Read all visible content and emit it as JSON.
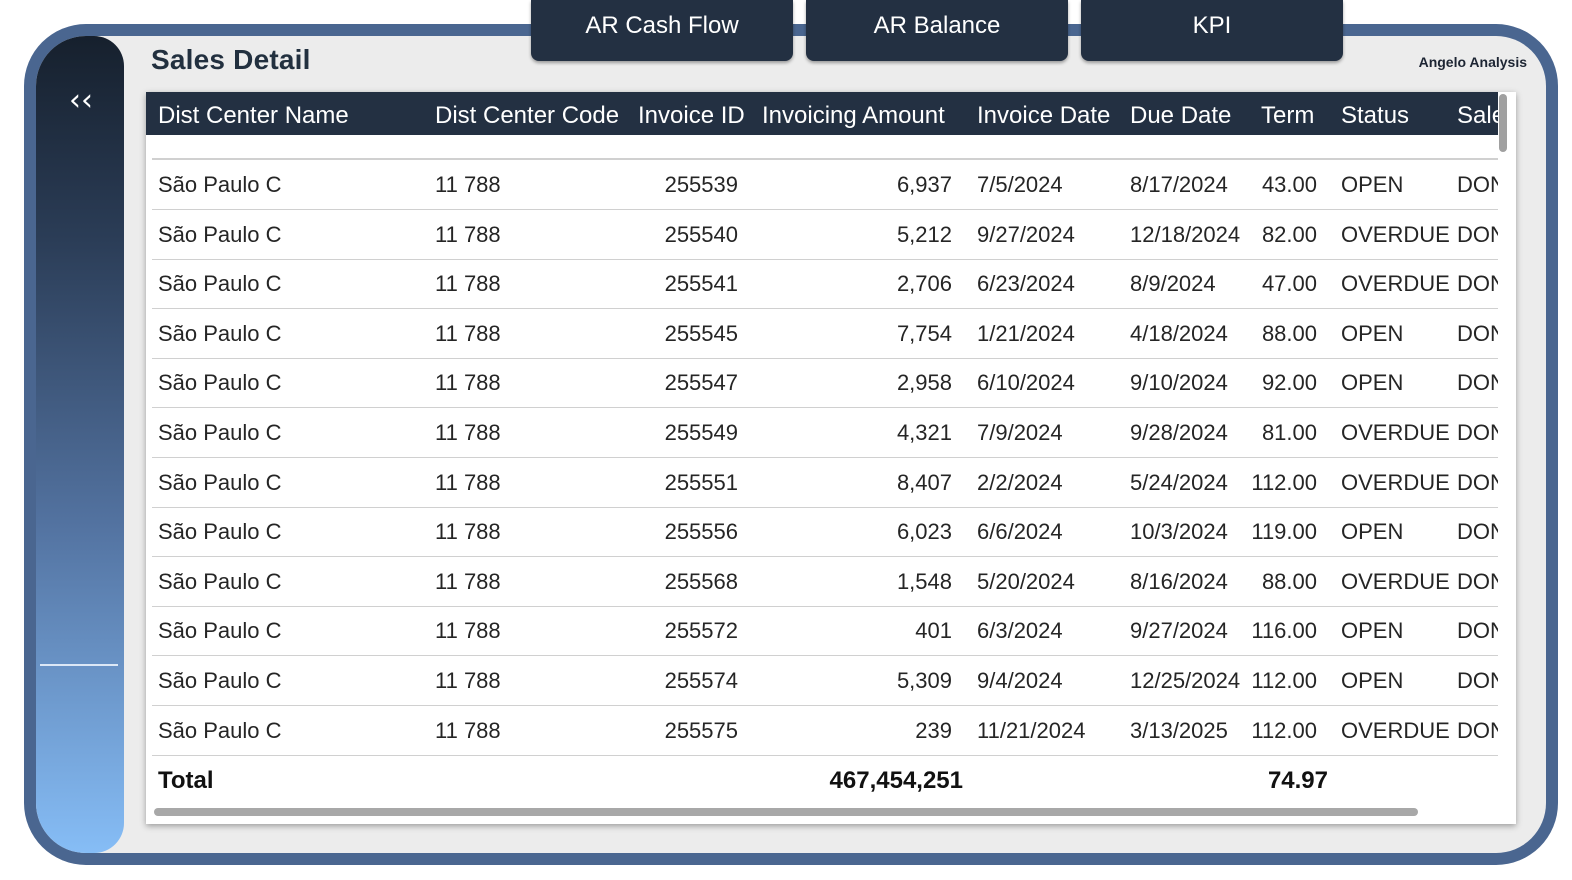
{
  "tabs": [
    {
      "label": "AR Cash Flow"
    },
    {
      "label": "AR Balance"
    },
    {
      "label": "KPI"
    }
  ],
  "sidebar": {
    "collapse_icon": "double-chevron-left-icon",
    "collapse_glyph": "‹‹"
  },
  "page": {
    "title": "Sales Detail",
    "brand": "Angelo Analysis"
  },
  "table": {
    "columns": [
      "Dist Center Name",
      "Dist Center Code",
      "Invoice ID",
      "Invoicing Amount",
      "Invoice Date",
      "Due Date",
      "Term",
      "Status",
      "Sale"
    ],
    "rows": [
      [
        "São Paulo C",
        "11 788",
        "255539",
        "6,937",
        "7/5/2024",
        "8/17/2024",
        "43.00",
        "OPEN",
        "DON"
      ],
      [
        "São Paulo C",
        "11 788",
        "255540",
        "5,212",
        "9/27/2024",
        "12/18/2024",
        "82.00",
        "OVERDUE",
        "DON"
      ],
      [
        "São Paulo C",
        "11 788",
        "255541",
        "2,706",
        "6/23/2024",
        "8/9/2024",
        "47.00",
        "OVERDUE",
        "DON"
      ],
      [
        "São Paulo C",
        "11 788",
        "255545",
        "7,754",
        "1/21/2024",
        "4/18/2024",
        "88.00",
        "OPEN",
        "DON"
      ],
      [
        "São Paulo C",
        "11 788",
        "255547",
        "2,958",
        "6/10/2024",
        "9/10/2024",
        "92.00",
        "OPEN",
        "DON"
      ],
      [
        "São Paulo C",
        "11 788",
        "255549",
        "4,321",
        "7/9/2024",
        "9/28/2024",
        "81.00",
        "OVERDUE",
        "DON"
      ],
      [
        "São Paulo C",
        "11 788",
        "255551",
        "8,407",
        "2/2/2024",
        "5/24/2024",
        "112.00",
        "OVERDUE",
        "DON"
      ],
      [
        "São Paulo C",
        "11 788",
        "255556",
        "6,023",
        "6/6/2024",
        "10/3/2024",
        "119.00",
        "OPEN",
        "DON"
      ],
      [
        "São Paulo C",
        "11 788",
        "255568",
        "1,548",
        "5/20/2024",
        "8/16/2024",
        "88.00",
        "OVERDUE",
        "DON"
      ],
      [
        "São Paulo C",
        "11 788",
        "255572",
        "401",
        "6/3/2024",
        "9/27/2024",
        "116.00",
        "OPEN",
        "DON"
      ],
      [
        "São Paulo C",
        "11 788",
        "255574",
        "5,309",
        "9/4/2024",
        "12/25/2024",
        "112.00",
        "OPEN",
        "DON"
      ],
      [
        "São Paulo C",
        "11 788",
        "255575",
        "239",
        "11/21/2024",
        "3/13/2025",
        "112.00",
        "OVERDUE",
        "DON"
      ]
    ],
    "total": {
      "label": "Total",
      "invoicing_amount": "467,454,251",
      "term": "74.97"
    }
  },
  "colors": {
    "frame": "#4a6690",
    "header": "#233042",
    "canvas": "#ececec"
  }
}
